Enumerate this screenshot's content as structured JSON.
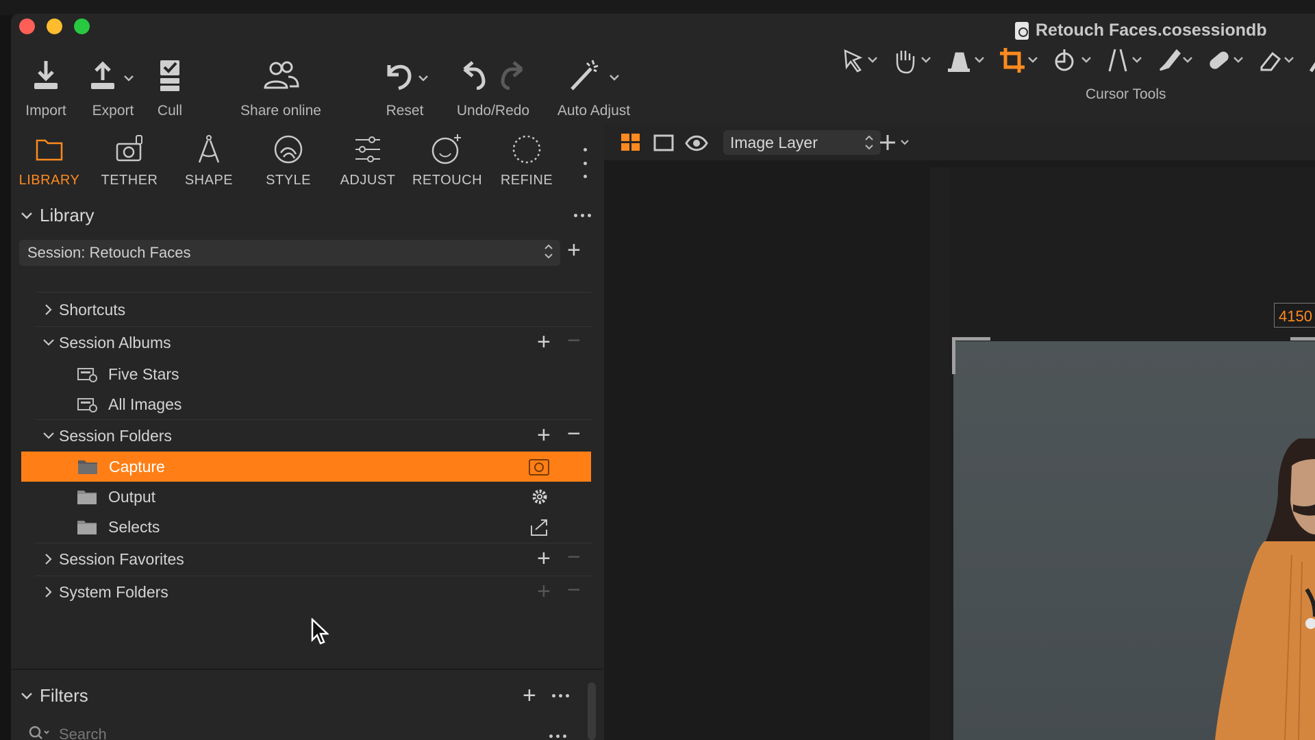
{
  "window": {
    "title": "Retouch Faces.cosessiondb"
  },
  "toolbar": {
    "import": "Import",
    "export": "Export",
    "cull": "Cull",
    "share_online": "Share online",
    "reset": "Reset",
    "undo_redo": "Undo/Redo",
    "auto_adjust": "Auto Adjust",
    "cursor_tools": "Cursor Tools"
  },
  "tool_tabs": {
    "library": "LIBRARY",
    "tether": "TETHER",
    "shape": "SHAPE",
    "style": "STYLE",
    "adjust": "ADJUST",
    "retouch": "RETOUCH",
    "refine": "REFINE"
  },
  "library": {
    "title": "Library",
    "session_select": "Session: Retouch Faces",
    "shortcuts": "Shortcuts",
    "session_albums": "Session Albums",
    "albums": [
      "Five Stars",
      "All Images"
    ],
    "session_folders": "Session Folders",
    "folders": [
      "Capture",
      "Output",
      "Selects"
    ],
    "selected_folder": "Capture",
    "session_favorites": "Session Favorites",
    "system_folders": "System Folders"
  },
  "filters": {
    "title": "Filters",
    "search_placeholder": "Search"
  },
  "viewer": {
    "layer": "Image Layer",
    "dimension_readout": "4150"
  },
  "colors": {
    "accent": "#ff7f16",
    "panel": "#272727",
    "viewer": "#191919"
  }
}
